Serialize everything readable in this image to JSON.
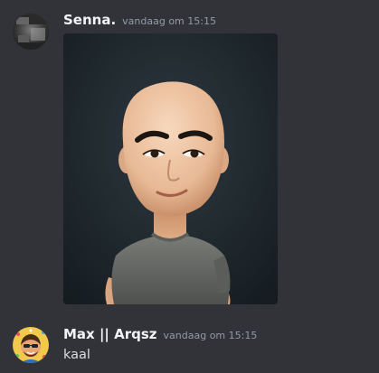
{
  "messages": [
    {
      "author": "Senna.",
      "timestamp": "vandaag om 15:15",
      "attachment": "image-attachment"
    },
    {
      "author": "Max || Arqsz",
      "timestamp": "vandaag om 15:15",
      "content": "kaal"
    }
  ]
}
